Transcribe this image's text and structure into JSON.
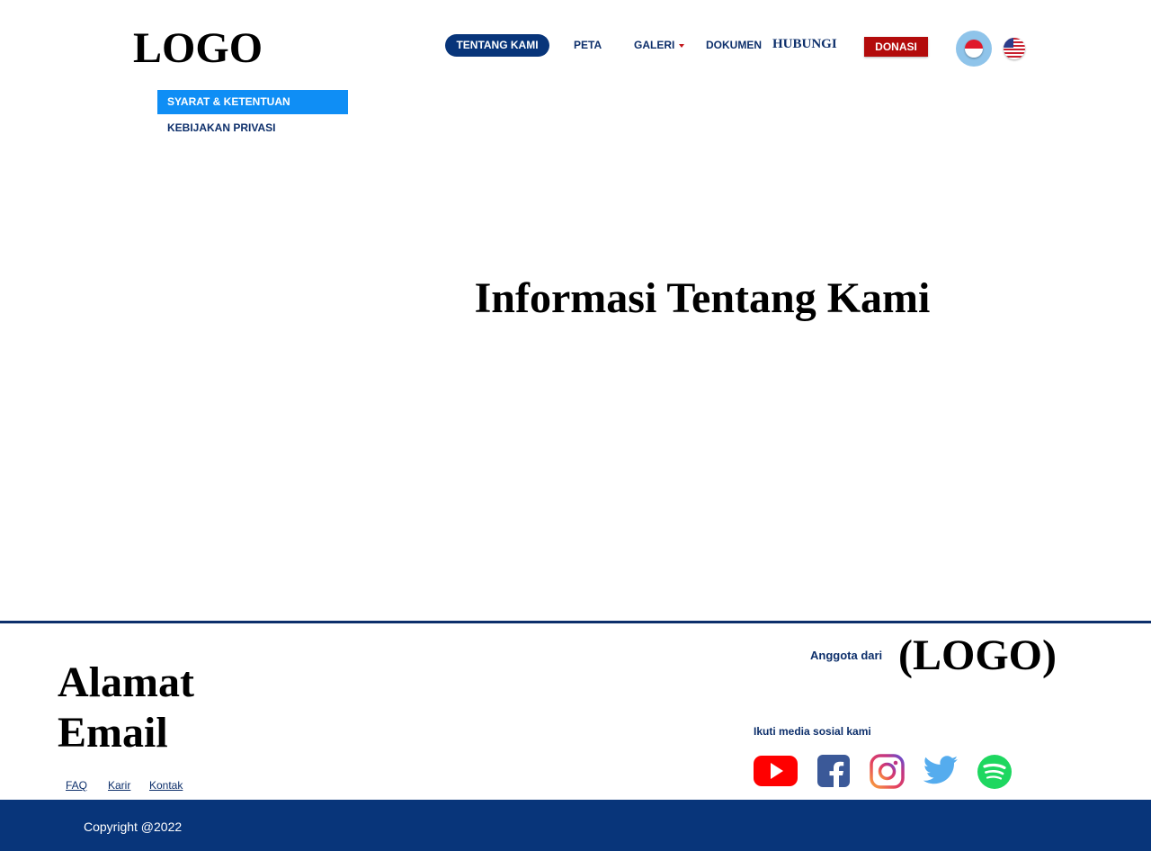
{
  "header": {
    "logo": "LOGO",
    "nav": {
      "tentang_kami": "TENTANG KAMI",
      "peta": "PETA",
      "galeri": "GALERI",
      "dokumen": "DOKUMEN",
      "hubungi": "HUBUNGI",
      "donasi": "DONASI"
    },
    "languages": [
      "id-flag-icon",
      "us-flag-icon"
    ]
  },
  "submenu": {
    "items": [
      "SYARAT & KETENTUAN",
      "KEBIJAKAN PRIVASI"
    ],
    "active": "SYARAT & KETENTUAN"
  },
  "main": {
    "heading": "Informasi Tentang Kami"
  },
  "footer": {
    "address": "Alamat",
    "email": "Email",
    "links": [
      "FAQ",
      "Karir",
      "Kontak"
    ],
    "member_of_label": "Anggota dari",
    "member_logo": "(LOGO)",
    "social_label": "Ikuti media sosial kami",
    "social_icons": [
      "youtube-icon",
      "facebook-icon",
      "instagram-icon",
      "twitter-icon",
      "spotify-icon"
    ],
    "copyright": "Copyright @2022"
  },
  "colors": {
    "navy": "#08357a",
    "active_blue": "#0f8ef5",
    "donate_red": "#b30b0b"
  }
}
